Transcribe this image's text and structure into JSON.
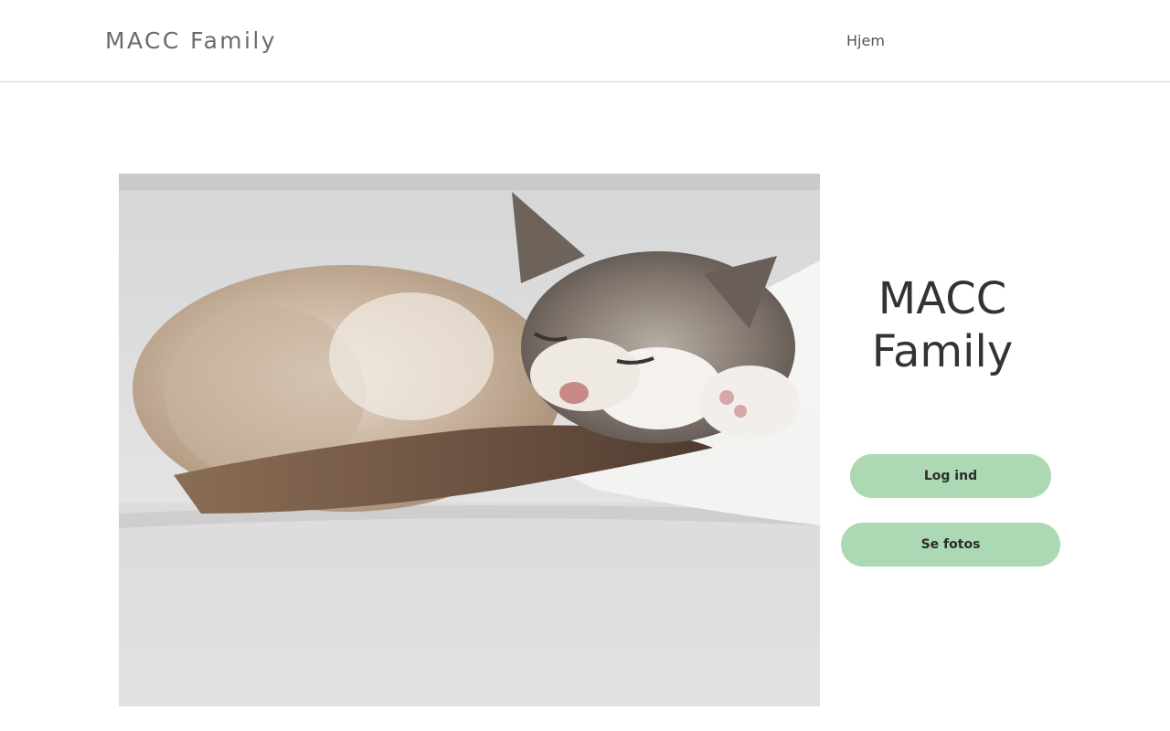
{
  "header": {
    "site_title": "MACC Family",
    "nav": [
      {
        "label": "Hjem"
      }
    ]
  },
  "main": {
    "hero_title": "MACC Family",
    "buttons": {
      "login_label": "Log ind",
      "photos_label": "Se fotos"
    },
    "photo": {
      "subject": "sleeping kitten on a cushion"
    }
  },
  "colors": {
    "button_bg": "#acd8b3",
    "title_text": "#333333",
    "site_title_text": "#6b6b6b",
    "header_border": "#d6d6d6"
  }
}
